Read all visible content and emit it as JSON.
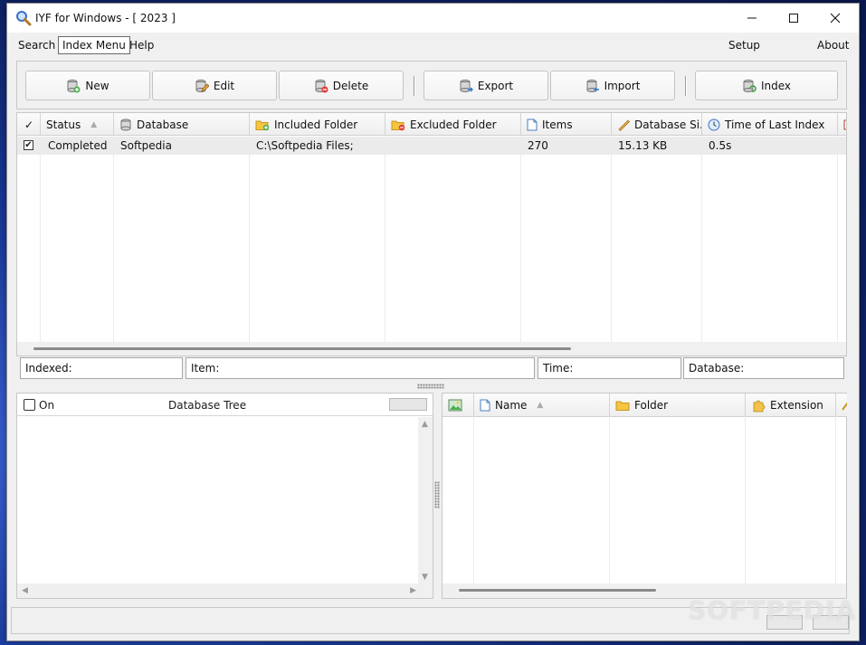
{
  "window": {
    "title": "IYF for Windows - [ 2023 ]"
  },
  "menu": {
    "search": "Search",
    "index_menu": "Index Menu",
    "help": "Help",
    "setup": "Setup",
    "about": "About"
  },
  "toolbar": {
    "new": "New",
    "edit": "Edit",
    "delete": "Delete",
    "export": "Export",
    "import": "Import",
    "index": "Index"
  },
  "index_grid": {
    "check_header": "✓",
    "columns": [
      "Status",
      "Database",
      "Included Folder",
      "Excluded Folder",
      "Items",
      "Database Si...",
      "Time of Last Index"
    ],
    "rows": [
      {
        "checked": "✔",
        "status": "Completed",
        "database": "Softpedia",
        "included": "C:\\Softpedia Files;",
        "excluded": "",
        "items": "270",
        "size": "15.13 KB",
        "time": "0.5s"
      }
    ]
  },
  "status_fields": {
    "indexed": "Indexed:",
    "item": "Item:",
    "time": "Time:",
    "database": "Database:"
  },
  "tree_pane": {
    "on_label": "On",
    "title": "Database Tree"
  },
  "files_pane": {
    "columns": [
      "Name",
      "Folder",
      "Extension"
    ]
  },
  "watermark": "SOFTPEDIA"
}
